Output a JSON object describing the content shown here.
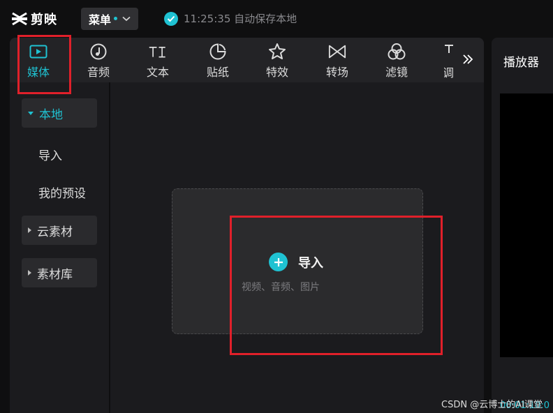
{
  "app": {
    "name": "剪映"
  },
  "header": {
    "menu_label": "菜单",
    "autosave_text": "11:25:35 自动保存本地"
  },
  "tabs": [
    {
      "label": "媒体",
      "icon": "media-icon",
      "active": true
    },
    {
      "label": "音频",
      "icon": "music-note-icon",
      "active": false
    },
    {
      "label": "文本",
      "icon": "text-icon",
      "active": false
    },
    {
      "label": "贴纸",
      "icon": "sticker-icon",
      "active": false
    },
    {
      "label": "特效",
      "icon": "sparkle-star-icon",
      "active": false
    },
    {
      "label": "转场",
      "icon": "transition-icon",
      "active": false
    },
    {
      "label": "滤镜",
      "icon": "filter-icon",
      "active": false
    }
  ],
  "tab_clipped_label": "调",
  "sidebar": {
    "local": "本地",
    "import": "导入",
    "my_presets": "我的预设",
    "cloud": "云素材",
    "library": "素材库"
  },
  "dropzone": {
    "label": "导入",
    "hint": "视频、音频、图片"
  },
  "player": {
    "title": "播放器",
    "time": "00:01:10:0"
  },
  "watermark": "CSDN @云博士的AI课堂",
  "colors": {
    "accent": "#1fc2d2",
    "highlight": "#e0202a",
    "panel": "#1b1b1e",
    "background": "#0f0f10"
  }
}
